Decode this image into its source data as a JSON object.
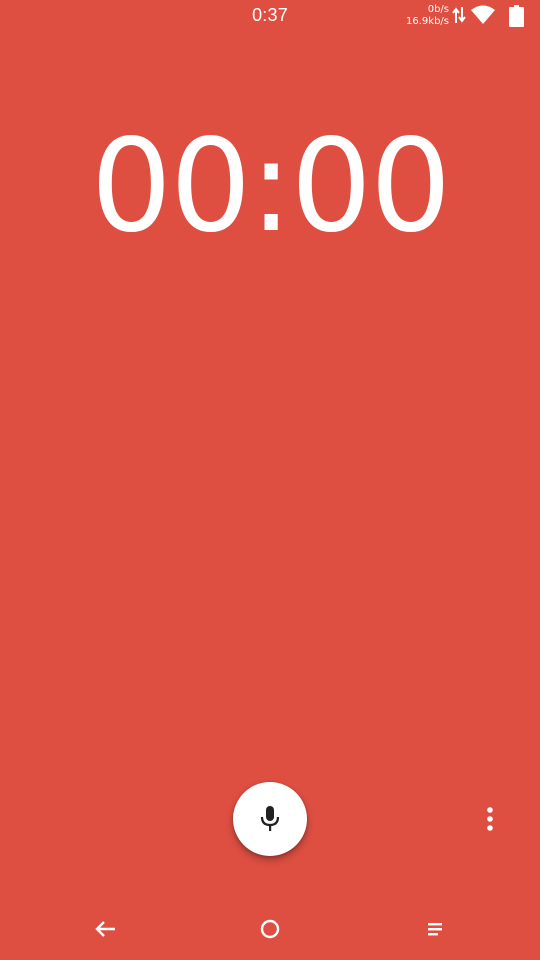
{
  "status_bar": {
    "time": "0:37",
    "upload_speed": "0b/s",
    "download_speed": "16.9kb/s",
    "icons": [
      "data-transfer-icon",
      "wifi-icon",
      "battery-icon"
    ]
  },
  "timer": {
    "display": "00:00"
  },
  "controls": {
    "primary_action_icon": "microphone-icon",
    "overflow_icon": "more-vert-icon"
  },
  "nav_bar": {
    "icons": [
      "back-icon",
      "home-icon",
      "recents-icon"
    ]
  },
  "colors": {
    "background": "#DE4F42",
    "foreground": "#FFFFFF",
    "button_surface": "#FFFFFF",
    "mic_icon": "#212121"
  }
}
